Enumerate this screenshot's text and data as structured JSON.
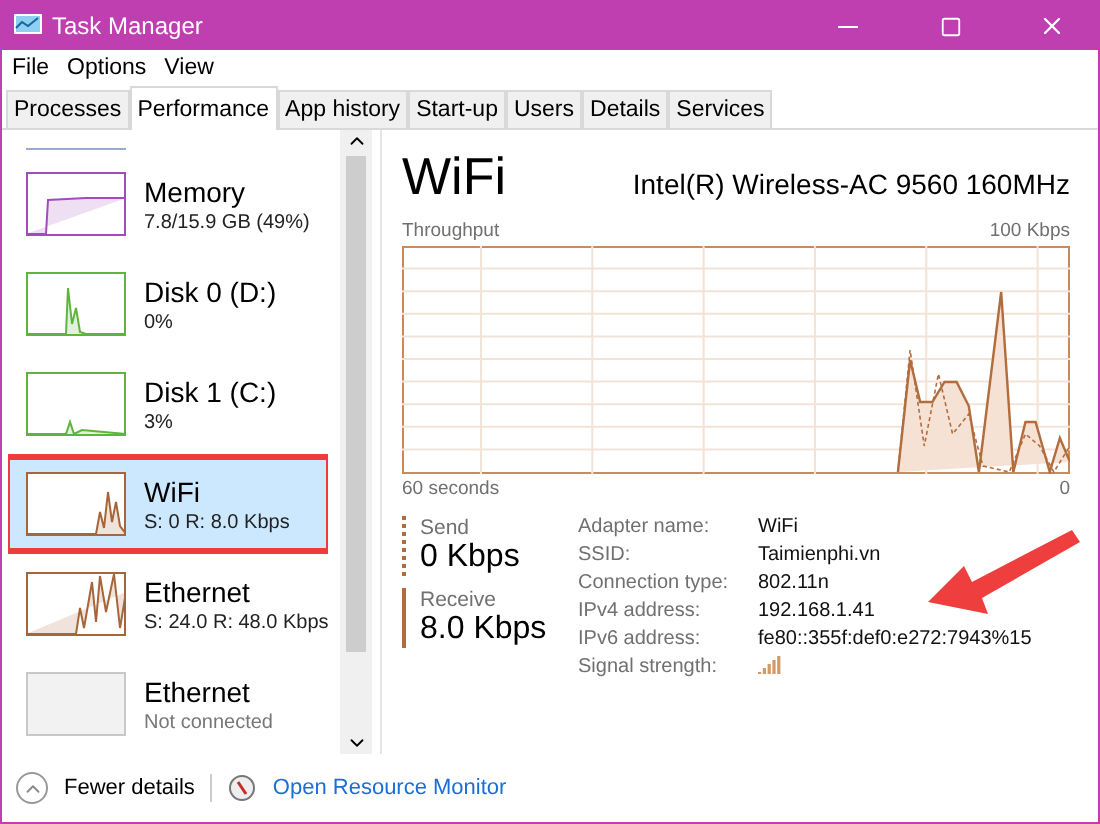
{
  "window": {
    "title": "Task Manager"
  },
  "menu": [
    "File",
    "Options",
    "View"
  ],
  "tabs": [
    {
      "label": "Processes",
      "selected": false
    },
    {
      "label": "Performance",
      "selected": true
    },
    {
      "label": "App history",
      "selected": false
    },
    {
      "label": "Start-up",
      "selected": false
    },
    {
      "label": "Users",
      "selected": false
    },
    {
      "label": "Details",
      "selected": false
    },
    {
      "label": "Services",
      "selected": false
    }
  ],
  "sidebar": {
    "items": [
      {
        "name": "Memory",
        "detail": "7.8/15.9 GB (49%)",
        "kind": "memory",
        "color": "#a24bbd",
        "selected": false,
        "highlighted": false
      },
      {
        "name": "Disk 0 (D:)",
        "detail": "0%",
        "kind": "disk",
        "color": "#5fb43e",
        "selected": false,
        "highlighted": false
      },
      {
        "name": "Disk 1 (C:)",
        "detail": "3%",
        "kind": "disk2",
        "color": "#5fb43e",
        "selected": false,
        "highlighted": false
      },
      {
        "name": "WiFi",
        "detail": "S: 0 R: 8.0 Kbps",
        "kind": "network",
        "color": "#a7653a",
        "selected": true,
        "highlighted": true
      },
      {
        "name": "Ethernet",
        "detail": "S: 24.0 R: 48.0 Kbps",
        "kind": "network2",
        "color": "#a7653a",
        "selected": false,
        "highlighted": false
      },
      {
        "name": "Ethernet",
        "detail": "Not connected",
        "kind": "off",
        "color": "#c8c8c8",
        "selected": false,
        "highlighted": false
      }
    ]
  },
  "panel": {
    "title": "WiFi",
    "adapter": "Intel(R) Wireless-AC 9560 160MHz",
    "graph": {
      "label": "Throughput",
      "max": "100 Kbps",
      "span": "60 seconds",
      "min": "0"
    },
    "send": {
      "label": "Send",
      "value": "0 Kbps"
    },
    "receive": {
      "label": "Receive",
      "value": "8.0 Kbps"
    },
    "properties": [
      {
        "label": "Adapter name:",
        "value": "WiFi"
      },
      {
        "label": "SSID:",
        "value": "Taimienphi.vn"
      },
      {
        "label": "Connection type:",
        "value": "802.11n"
      },
      {
        "label": "IPv4 address:",
        "value": "192.168.1.41"
      },
      {
        "label": "IPv6 address:",
        "value": "fe80::355f:def0:e272:7943%15"
      },
      {
        "label": "Signal strength:",
        "kind": "signal"
      }
    ],
    "annotation": {
      "kind": "arrow"
    }
  },
  "footer": {
    "fewer": "Fewer details",
    "monitor": "Open Resource Monitor"
  }
}
